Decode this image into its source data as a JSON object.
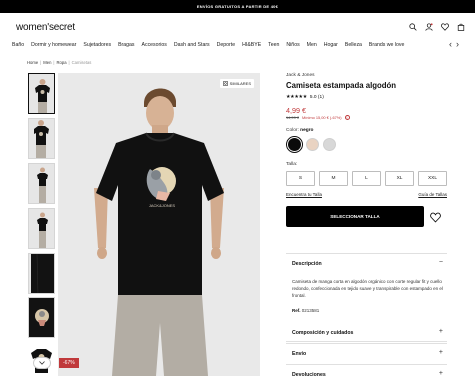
{
  "promo": {
    "text": "ENVÍOS GRATUITOS A PARTIR DE 40€"
  },
  "header": {
    "logo": "women'secret"
  },
  "nav": {
    "items": [
      "Baño",
      "Dormir y homewear",
      "Sujetadores",
      "Bragas",
      "Accesorios",
      "Dash and Stars",
      "Deporte",
      "HI&BYE",
      "Teen",
      "Niños",
      "Men",
      "Hogar",
      "Belleza",
      "Brands we love"
    ],
    "prev_icon": "‹",
    "next_icon": "›"
  },
  "breadcrumb": {
    "items": [
      "Home",
      "Men",
      "Ropa",
      "Camisetas"
    ],
    "separator": "|"
  },
  "gallery": {
    "similar_label": "SIMILARES",
    "discount_badge": "-67%",
    "scroll_down_icon": "chevron-down-icon"
  },
  "product": {
    "brand": "Jack & Jones",
    "title": "Camiseta estampada algodón",
    "rating_stars": "★★★★★",
    "rating": "5.0 (1)",
    "price": "4,99 €",
    "old_price": "14,99 €",
    "min_price": "Mínimo 15,00 € (-67%)",
    "info_icon": "i",
    "color_label": "Color:",
    "color_value": "negro",
    "colors": [
      "#0b0b0b",
      "#e9d3c2",
      "#d8d8d8"
    ],
    "size_label": "Talla:",
    "sizes": [
      "S",
      "M",
      "L",
      "XL",
      "XXL"
    ],
    "size_find_link": "Encuentra tu Talla",
    "size_guide_link": "Guía de Tallas",
    "cta_label": "SELECCIONAR TALLA"
  },
  "accordion": {
    "description_title": "Descripción",
    "description_sign": "−",
    "description_text": "Camiseta de manga corta en algodón orgánico con corte regular fit y cuello redondo, confeccionada en tejido suave y transpirable con estampado en el frontal.",
    "ref_label": "Ref.",
    "ref_value": "0213581",
    "composition_title": "Composición y cuidados",
    "shipping_title": "Envío",
    "returns_title": "Devoluciones",
    "plus_sign": "+"
  }
}
